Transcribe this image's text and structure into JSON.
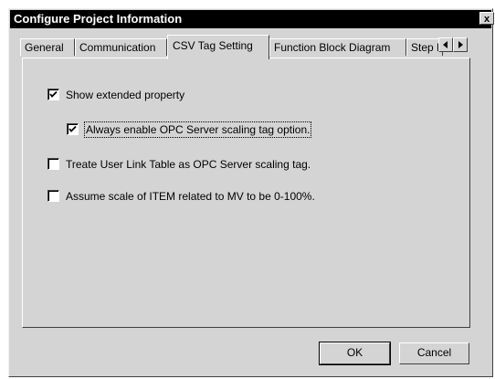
{
  "window": {
    "title": "Configure Project Information",
    "close_label": "x"
  },
  "tabs": [
    {
      "label": "General",
      "active": false
    },
    {
      "label": "Communication",
      "active": false
    },
    {
      "label": "CSV Tag Setting",
      "active": true
    },
    {
      "label": "Function Block Diagram",
      "active": false
    },
    {
      "label": "Step La",
      "active": false
    }
  ],
  "tab_scroll": {
    "left_icon": "scroll-left-icon",
    "right_icon": "scroll-right-icon"
  },
  "options": [
    {
      "label": "Show extended property",
      "checked": true
    },
    {
      "label": "Always enable OPC Server scaling tag option.",
      "checked": true,
      "focused": true
    },
    {
      "label": "Treate User Link Table as OPC Server scaling tag.",
      "checked": false
    },
    {
      "label": "Assume scale of ITEM related to MV to be 0-100%.",
      "checked": false
    }
  ],
  "buttons": {
    "ok": "OK",
    "cancel": "Cancel"
  }
}
